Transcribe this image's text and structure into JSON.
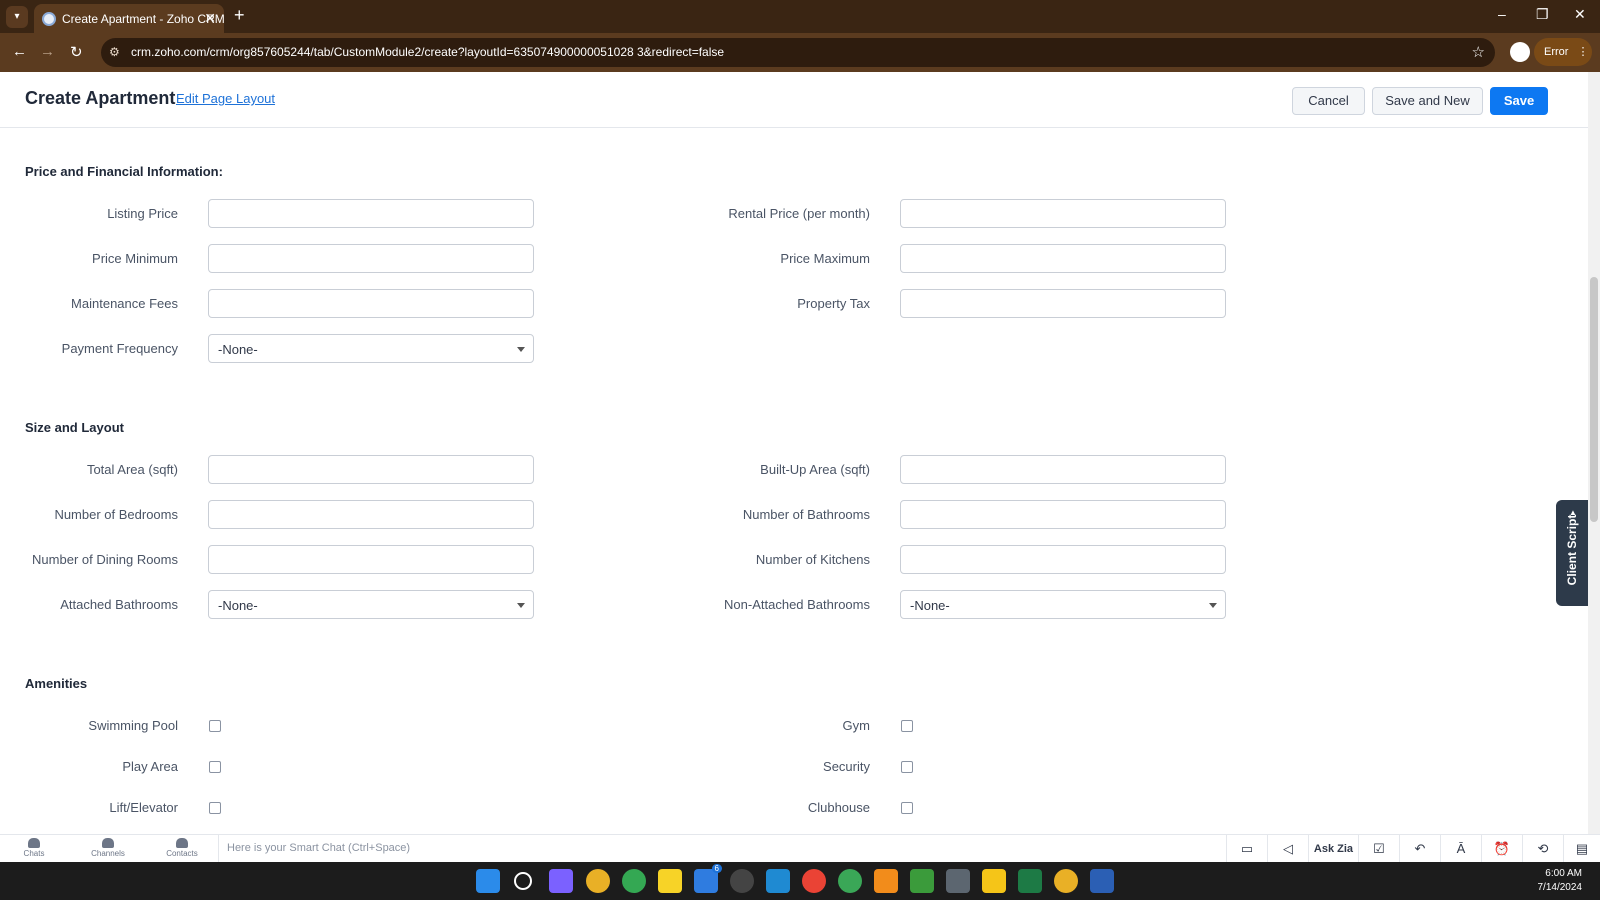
{
  "browser": {
    "tab_title": "Create Apartment - Zoho CRM",
    "tab_close": "✕",
    "new_tab": "+",
    "url": "crm.zoho.com/crm/org857605244/tab/CustomModule2/create?layoutId=635074900000051028 3&redirect=false",
    "profile_status": "Error",
    "window_controls": [
      "–",
      "❐",
      "✕"
    ]
  },
  "header": {
    "title": "Create Apartment",
    "edit_layout": "Edit Page Layout",
    "cancel": "Cancel",
    "save_and_new": "Save and New",
    "save": "Save"
  },
  "sections": {
    "price": {
      "title": "Price and Financial Information:",
      "listing_price": "Listing Price",
      "rental_price": "Rental Price (per month)",
      "price_min": "Price Minimum",
      "price_max": "Price Maximum",
      "maintenance": "Maintenance Fees",
      "property_tax": "Property Tax",
      "payment_freq": "Payment Frequency",
      "payment_freq_value": "-None-"
    },
    "size": {
      "title": "Size and Layout",
      "total_area": "Total Area (sqft)",
      "built_up_area": "Built-Up Area (sqft)",
      "bedrooms": "Number of Bedrooms",
      "bathrooms": "Number of Bathrooms",
      "dining_rooms": "Number of Dining Rooms",
      "kitchens": "Number of Kitchens",
      "attached_bath": "Attached Bathrooms",
      "attached_bath_value": "-None-",
      "non_attached_bath": "Non-Attached Bathrooms",
      "non_attached_bath_value": "-None-"
    },
    "amenities": {
      "title": "Amenities",
      "swimming_pool": "Swimming Pool",
      "gym": "Gym",
      "play_area": "Play Area",
      "security": "Security",
      "lift": "Lift/Elevator",
      "clubhouse": "Clubhouse"
    }
  },
  "client_script": "Client Script",
  "chatbar": {
    "chats": "Chats",
    "channels": "Channels",
    "contacts": "Contacts",
    "placeholder": "Here is your Smart Chat (Ctrl+Space)",
    "ask_zia": "Ask Zia"
  },
  "taskbar": {
    "time": "6:00 AM",
    "date": "7/14/2024",
    "badge": "6"
  },
  "colors": {
    "accent": "#0d78f2",
    "chrome": "#5b3b1f"
  }
}
